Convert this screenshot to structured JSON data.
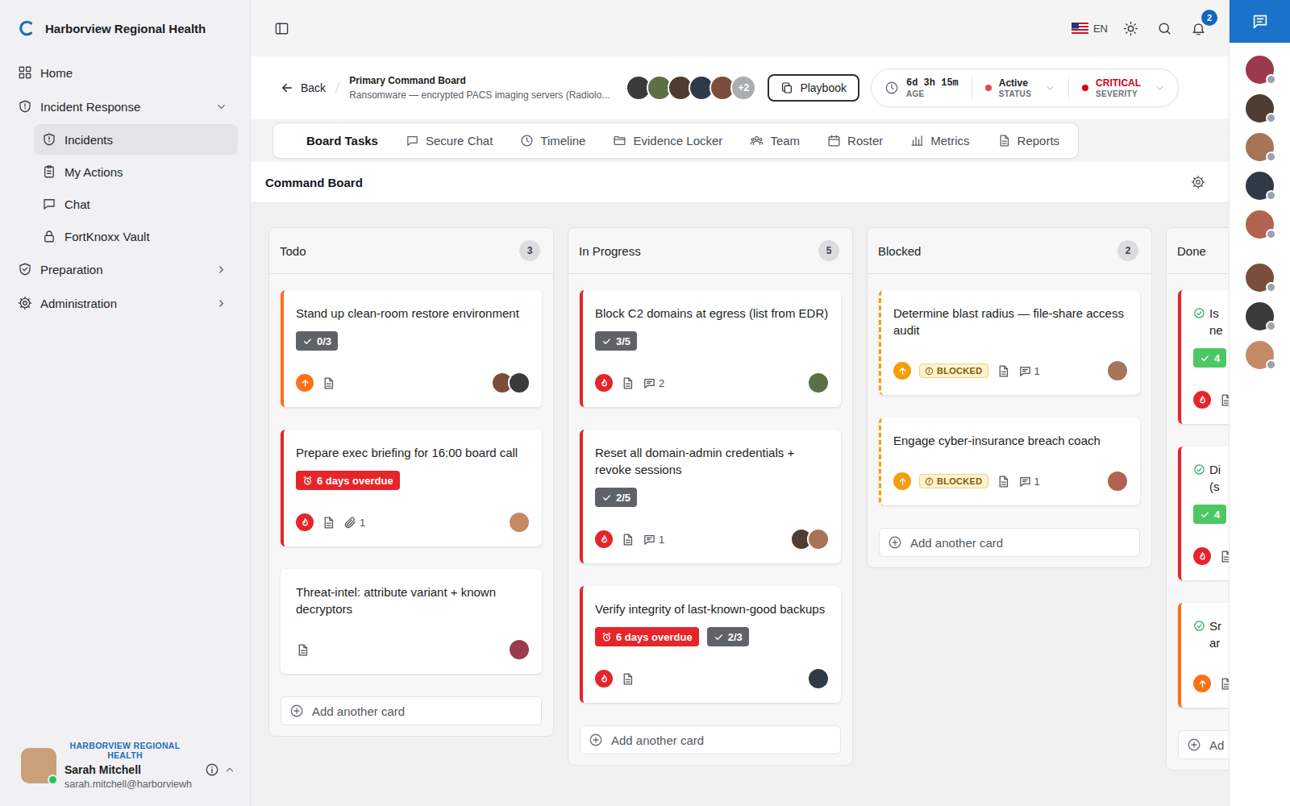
{
  "brand": {
    "name": "Harborview Regional Health"
  },
  "sidebar": {
    "items": [
      {
        "label": "Home",
        "expandable": false,
        "expanded": false,
        "selected": false,
        "children": []
      },
      {
        "label": "Incident Response",
        "expandable": true,
        "expanded": true,
        "selected": false,
        "children": [
          {
            "label": "Incidents",
            "selected": true
          },
          {
            "label": "My Actions",
            "selected": false
          },
          {
            "label": "Chat",
            "selected": false
          },
          {
            "label": "FortKnoxx Vault",
            "selected": false
          }
        ]
      },
      {
        "label": "Preparation",
        "expandable": true,
        "expanded": false,
        "selected": false,
        "children": []
      },
      {
        "label": "Administration",
        "expandable": true,
        "expanded": false,
        "selected": false,
        "children": []
      }
    ]
  },
  "user": {
    "org": "HARBORVIEW REGIONAL HEALTH",
    "name": "Sarah Mitchell",
    "email": "sarah.mitchell@harborviewh",
    "online": true
  },
  "topbar": {
    "language": "EN",
    "notifications": "2"
  },
  "rail": {
    "people": [
      {
        "online": false
      },
      {
        "online": false
      },
      {
        "online": false
      },
      {
        "online": false
      },
      {
        "online": false
      },
      {
        "online": false
      },
      {
        "online": false
      },
      {
        "online": false
      }
    ]
  },
  "incident": {
    "back": "Back",
    "board": "Primary Command Board",
    "title": "Ransomware — encrypted PACS imaging servers (Radiolo...",
    "members_shown": 5,
    "members_more": "+2",
    "playbook": "Playbook",
    "age": {
      "value": "6d 3h 15m",
      "label": "AGE"
    },
    "status": {
      "value": "Active",
      "label": "STATUS",
      "color": "#e5484d"
    },
    "severity": {
      "value": "CRITICAL",
      "label": "SEVERITY",
      "color": "#d0021b"
    }
  },
  "tabs": [
    {
      "label": "Board Tasks",
      "selected": true
    },
    {
      "label": "Secure Chat",
      "selected": false
    },
    {
      "label": "Timeline",
      "selected": false
    },
    {
      "label": "Evidence Locker",
      "selected": false
    },
    {
      "label": "Team",
      "selected": false
    },
    {
      "label": "Roster",
      "selected": false
    },
    {
      "label": "Metrics",
      "selected": false
    },
    {
      "label": "Reports",
      "selected": false
    }
  ],
  "board": {
    "title": "Command Board",
    "columns": [
      {
        "title": "Todo",
        "count": "3",
        "add": "Add another card",
        "cards": [
          {
            "kind": "task",
            "title": "Stand up clean-room restore environment",
            "lines": [],
            "color": "#f97316",
            "priority": "high",
            "blocked": false,
            "blocked_label": null,
            "checklist": "0/3",
            "overdue": null,
            "has_doc": true,
            "attachments": null,
            "comments": null,
            "assignees": 2
          },
          {
            "kind": "task",
            "title": "Prepare exec briefing for 16:00 board call",
            "lines": [],
            "color": "#e5252a",
            "priority": "urgent",
            "blocked": false,
            "blocked_label": null,
            "checklist": null,
            "overdue": "6 days overdue",
            "has_doc": true,
            "attachments": "1",
            "comments": null,
            "assignees": 1
          },
          {
            "kind": "task",
            "title": "Threat-intel: attribute variant + known decryptors",
            "lines": [],
            "color": null,
            "priority": "none",
            "blocked": false,
            "blocked_label": null,
            "checklist": null,
            "overdue": null,
            "has_doc": true,
            "attachments": null,
            "comments": null,
            "assignees": 1
          }
        ]
      },
      {
        "title": "In Progress",
        "count": "5",
        "add": "Add another card",
        "cards": [
          {
            "kind": "task",
            "title": "Block C2 domains at egress (list from EDR)",
            "lines": [],
            "color": "#e5252a",
            "priority": "urgent",
            "blocked": false,
            "blocked_label": null,
            "checklist": "3/5",
            "overdue": null,
            "has_doc": true,
            "attachments": null,
            "comments": "2",
            "assignees": 1
          },
          {
            "kind": "task",
            "title": "Reset all domain-admin credentials + revoke sessions",
            "lines": [],
            "color": "#e5252a",
            "priority": "urgent",
            "blocked": false,
            "blocked_label": null,
            "checklist": "2/5",
            "overdue": null,
            "has_doc": true,
            "attachments": null,
            "comments": "1",
            "assignees": 2
          },
          {
            "kind": "task",
            "title": "Verify integrity of last-known-good backups",
            "lines": [],
            "color": "#e5252a",
            "priority": "urgent",
            "blocked": false,
            "blocked_label": null,
            "checklist": "2/3",
            "overdue": "6 days overdue",
            "has_doc": true,
            "attachments": null,
            "comments": null,
            "assignees": 1
          }
        ]
      },
      {
        "title": "Blocked",
        "count": "2",
        "add": "Add another card",
        "cards": [
          {
            "kind": "task",
            "title": "Determine blast radius — file-share access audit",
            "lines": [],
            "color": "#f59e0b",
            "priority": "high",
            "blocked": true,
            "blocked_label": "BLOCKED",
            "checklist": null,
            "overdue": null,
            "has_doc": true,
            "attachments": null,
            "comments": "1",
            "assignees": 1
          },
          {
            "kind": "task",
            "title": "Engage cyber-insurance breach coach",
            "lines": [],
            "color": "#f59e0b",
            "priority": "high",
            "blocked": true,
            "blocked_label": "BLOCKED",
            "checklist": null,
            "overdue": null,
            "has_doc": true,
            "attachments": null,
            "comments": "1",
            "assignees": 1
          }
        ]
      },
      {
        "title": "Done",
        "count": null,
        "add": "Ad",
        "cards": [
          {
            "kind": "done",
            "title": null,
            "lines": [
              "Is",
              "ne"
            ],
            "color": "#e5252a",
            "priority": "urgent",
            "blocked": false,
            "blocked_label": null,
            "checklist": "4",
            "overdue": null,
            "has_doc": true,
            "attachments": null,
            "comments": null,
            "assignees": 0
          },
          {
            "kind": "done",
            "title": null,
            "lines": [
              "Di",
              "(s"
            ],
            "color": "#e5252a",
            "priority": "urgent",
            "blocked": false,
            "blocked_label": null,
            "checklist": "4",
            "overdue": null,
            "has_doc": true,
            "attachments": null,
            "comments": null,
            "assignees": 0
          },
          {
            "kind": "done",
            "title": null,
            "lines": [
              "Sr",
              "ar"
            ],
            "color": "#f97316",
            "priority": "high",
            "blocked": false,
            "blocked_label": null,
            "checklist": null,
            "overdue": null,
            "has_doc": true,
            "attachments": null,
            "comments": null,
            "assignees": 0
          }
        ]
      }
    ]
  }
}
